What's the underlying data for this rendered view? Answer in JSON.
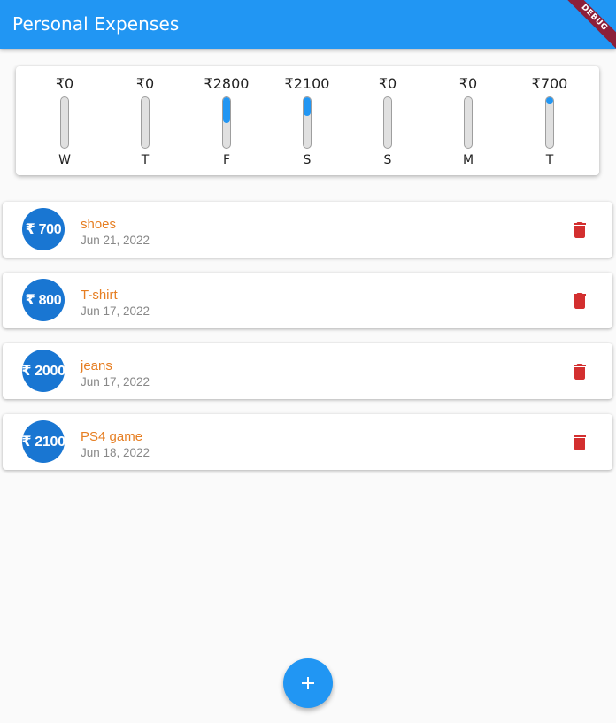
{
  "app": {
    "title": "Personal Expenses",
    "debug_label": "DEBUG"
  },
  "colors": {
    "primary": "#2196f3",
    "avatar": "#1976d2",
    "title_accent": "#e67e22",
    "delete": "#d32f2f",
    "debug_ribbon": "#8c1f3a"
  },
  "chart": {
    "bars": [
      {
        "day": "W",
        "amount": "₹0",
        "fraction": 0
      },
      {
        "day": "T",
        "amount": "₹0",
        "fraction": 0
      },
      {
        "day": "F",
        "amount": "₹2800",
        "fraction": 0.5
      },
      {
        "day": "S",
        "amount": "₹2100",
        "fraction": 0.375
      },
      {
        "day": "S",
        "amount": "₹0",
        "fraction": 0
      },
      {
        "day": "M",
        "amount": "₹0",
        "fraction": 0
      },
      {
        "day": "T",
        "amount": "₹700",
        "fraction": 0.125
      }
    ]
  },
  "transactions": [
    {
      "amount": "₹ 700",
      "title": "shoes",
      "date": "Jun 21, 2022",
      "delete_icon": "delete-icon"
    },
    {
      "amount": "₹ 800",
      "title": "T-shirt",
      "date": "Jun 17, 2022",
      "delete_icon": "delete-icon"
    },
    {
      "amount": "₹ 2000",
      "title": "jeans",
      "date": "Jun 17, 2022",
      "delete_icon": "delete-icon"
    },
    {
      "amount": "₹ 2100",
      "title": "PS4 game",
      "date": "Jun 18, 2022",
      "delete_icon": "delete-icon"
    }
  ],
  "fab": {
    "icon": "add-icon"
  }
}
